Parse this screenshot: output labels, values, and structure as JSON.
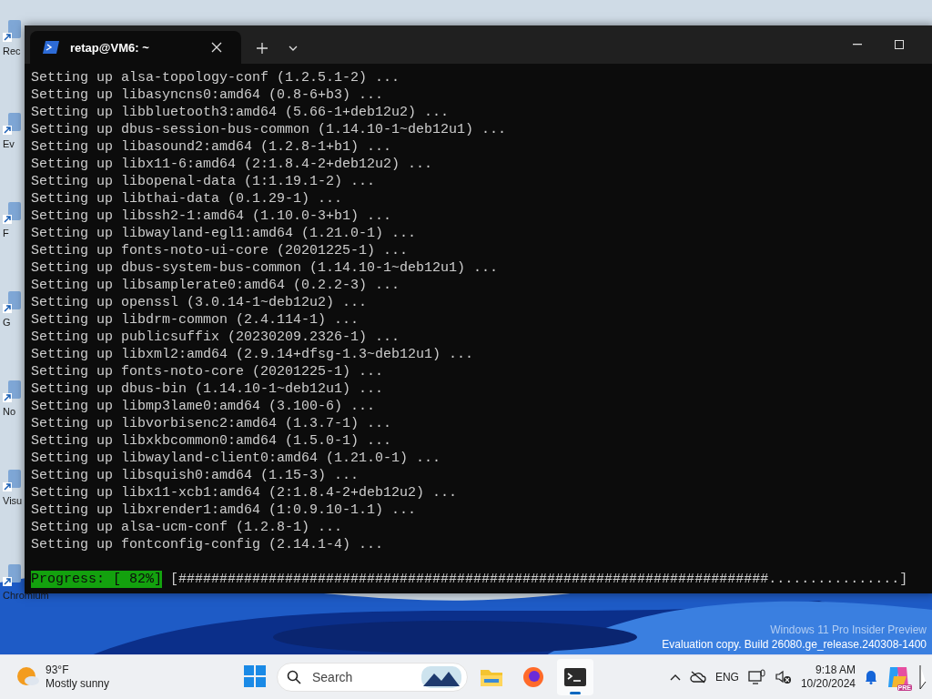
{
  "desktop": {
    "icons": [
      {
        "label": "Rec"
      },
      {
        "label": "Ev"
      },
      {
        "label": "F"
      },
      {
        "label": "G"
      },
      {
        "label": "No"
      },
      {
        "label": "Visu"
      },
      {
        "label": "Chromium"
      }
    ],
    "watermark": [
      "Windows 11 Pro Insider Preview",
      "Evaluation copy. Build 26080.ge_release.240308-1400"
    ]
  },
  "terminal": {
    "tab": {
      "title": "retap@VM6: ~",
      "selected": true
    },
    "lines": [
      "Setting up alsa-topology-conf (1.2.5.1-2) ...",
      "Setting up libasyncns0:amd64 (0.8-6+b3) ...",
      "Setting up libbluetooth3:amd64 (5.66-1+deb12u2) ...",
      "Setting up dbus-session-bus-common (1.14.10-1~deb12u1) ...",
      "Setting up libasound2:amd64 (1.2.8-1+b1) ...",
      "Setting up libx11-6:amd64 (2:1.8.4-2+deb12u2) ...",
      "Setting up libopenal-data (1:1.19.1-2) ...",
      "Setting up libthai-data (0.1.29-1) ...",
      "Setting up libssh2-1:amd64 (1.10.0-3+b1) ...",
      "Setting up libwayland-egl1:amd64 (1.21.0-1) ...",
      "Setting up fonts-noto-ui-core (20201225-1) ...",
      "Setting up dbus-system-bus-common (1.14.10-1~deb12u1) ...",
      "Setting up libsamplerate0:amd64 (0.2.2-3) ...",
      "Setting up openssl (3.0.14-1~deb12u2) ...",
      "Setting up libdrm-common (2.4.114-1) ...",
      "Setting up publicsuffix (20230209.2326-1) ...",
      "Setting up libxml2:amd64 (2.9.14+dfsg-1.3~deb12u1) ...",
      "Setting up fonts-noto-core (20201225-1) ...",
      "Setting up dbus-bin (1.14.10-1~deb12u1) ...",
      "Setting up libmp3lame0:amd64 (3.100-6) ...",
      "Setting up libvorbisenc2:amd64 (1.3.7-1) ...",
      "Setting up libxkbcommon0:amd64 (1.5.0-1) ...",
      "Setting up libwayland-client0:amd64 (1.21.0-1) ...",
      "Setting up libsquish0:amd64 (1.15-3) ...",
      "Setting up libx11-xcb1:amd64 (2:1.8.4-2+deb12u2) ...",
      "Setting up libxrender1:amd64 (1:0.9.10-1.1) ...",
      "Setting up alsa-ucm-conf (1.2.8-1) ...",
      "Setting up fontconfig-config (2.14.1-4) ..."
    ],
    "progress": {
      "label": "Progress: [ 82%]",
      "bar": "[########################################################################................]"
    }
  },
  "taskbar": {
    "weather": {
      "temp": "93°F",
      "condition": "Mostly sunny"
    },
    "search": {
      "placeholder": "Search"
    },
    "apps": [
      {
        "kind": "files",
        "active": false
      },
      {
        "kind": "firefox",
        "active": false
      },
      {
        "kind": "terminal",
        "active": true
      }
    ],
    "tray": {
      "language": "ENG",
      "time": "9:18 AM",
      "date": "10/20/2024",
      "badge": "PRE"
    }
  }
}
